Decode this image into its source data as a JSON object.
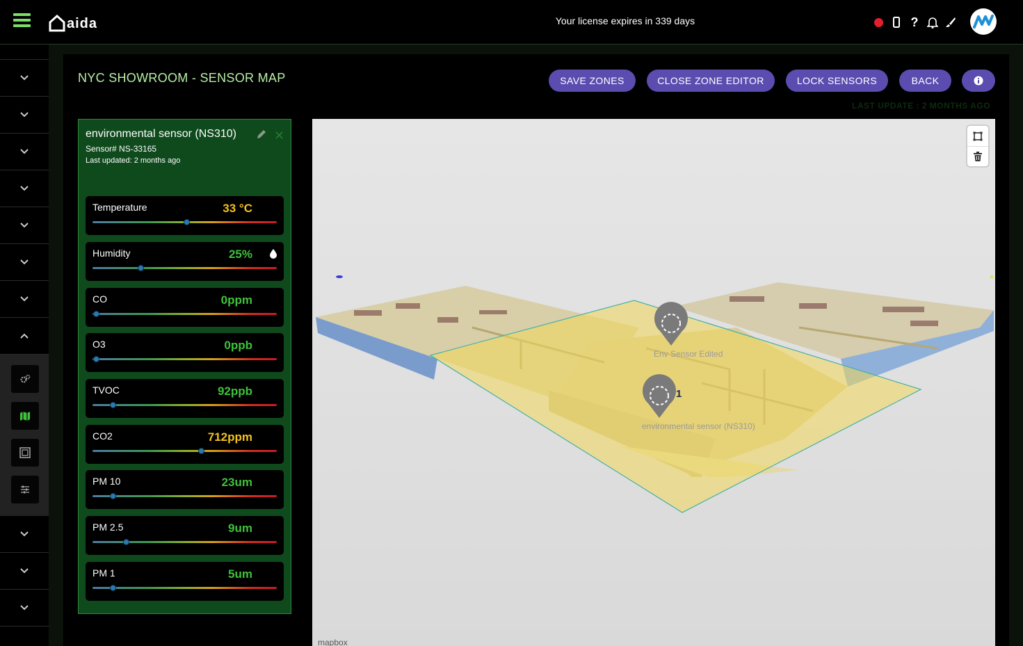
{
  "header": {
    "logo_text": "aida",
    "license_text": "Your license expires in 339 days",
    "icons": [
      "record-icon",
      "phone-icon",
      "help-icon",
      "bell-icon",
      "brush-icon"
    ]
  },
  "sidebar": {
    "items_above": 8,
    "sub_items": [
      "settings-icon",
      "map-icon",
      "zone-icon",
      "sliders-icon"
    ],
    "items_below": 3
  },
  "page": {
    "title": "NYC SHOWROOM - SENSOR MAP",
    "last_update": "LAST UPDATE : 2 MONTHS AGO"
  },
  "toolbar": {
    "save_zones": "SAVE ZONES",
    "close_zone_editor": "CLOSE ZONE EDITOR",
    "lock_sensors": "LOCK SENSORS",
    "back": "BACK",
    "info": "i"
  },
  "sensor_panel": {
    "title": "environmental sensor (NS310)",
    "sensor_number": "Sensor# NS-33165",
    "last_updated": "Last updated: 2 months ago",
    "readings": [
      {
        "label": "Temperature",
        "value": "33 °C",
        "level": 0.51,
        "color": "#f4c21b"
      },
      {
        "label": "Humidity",
        "value": "25%",
        "level": 0.26,
        "color": "#3fc23a"
      },
      {
        "label": "CO",
        "value": "0ppm",
        "level": 0.02,
        "color": "#3fc23a"
      },
      {
        "label": "O3",
        "value": "0ppb",
        "level": 0.02,
        "color": "#3fc23a"
      },
      {
        "label": "TVOC",
        "value": "92ppb",
        "level": 0.11,
        "color": "#3fc23a"
      },
      {
        "label": "CO2",
        "value": "712ppm",
        "level": 0.59,
        "color": "#f4c21b"
      },
      {
        "label": "PM 10",
        "value": "23um",
        "level": 0.11,
        "color": "#3fc23a"
      },
      {
        "label": "PM 2.5",
        "value": "9um",
        "level": 0.18,
        "color": "#3fc23a"
      },
      {
        "label": "PM 1",
        "value": "5um",
        "level": 0.11,
        "color": "#3fc23a"
      }
    ]
  },
  "map": {
    "sensors": [
      {
        "label": "Env Sensor Edited"
      },
      {
        "label": "environmental sensor (NS310)",
        "badge": "1"
      }
    ],
    "controls": [
      "polygon-icon",
      "trash-icon"
    ],
    "attribution": "mapbox"
  }
}
